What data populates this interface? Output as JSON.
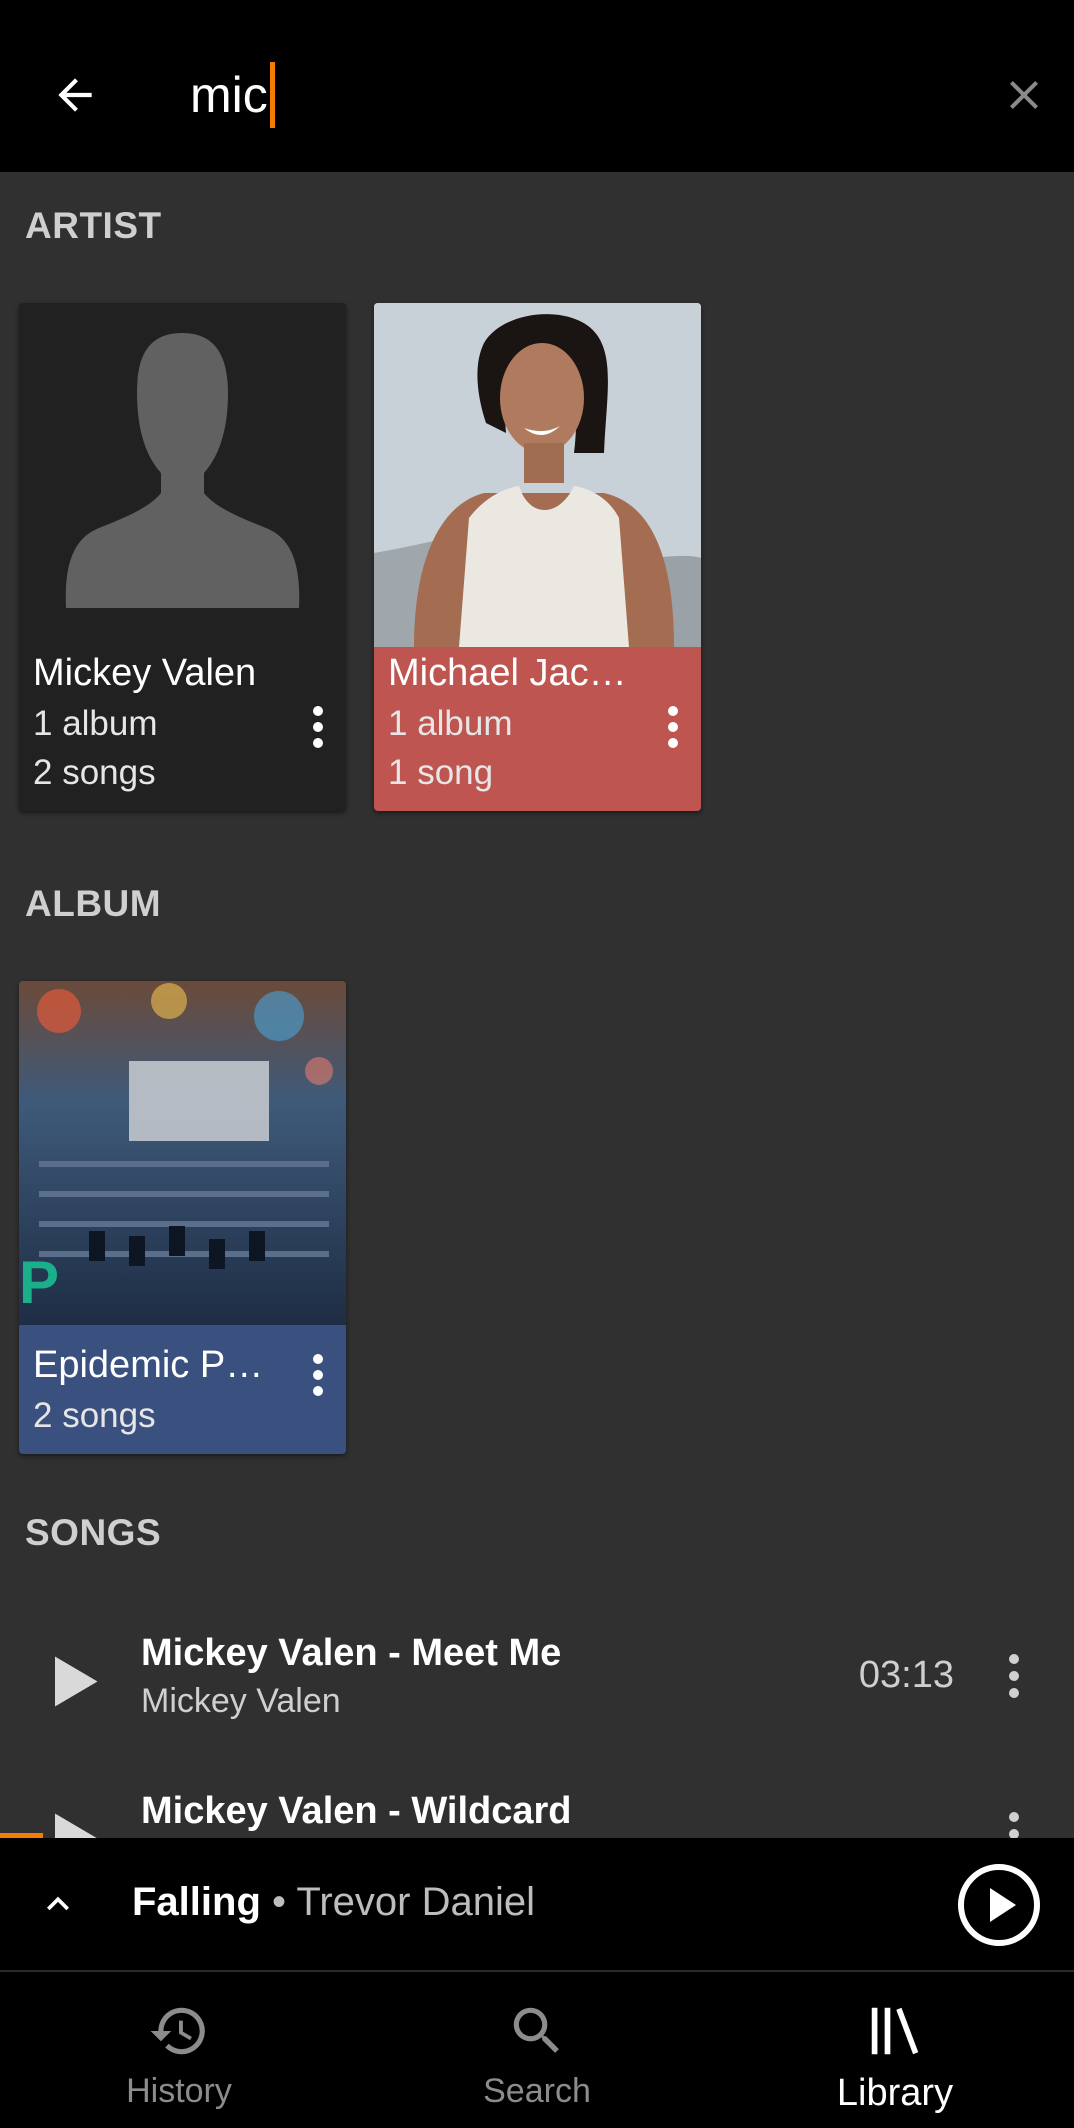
{
  "search": {
    "query": "mic"
  },
  "sections": {
    "artist": "ARTIST",
    "album": "ALBUM",
    "songs": "SONGS"
  },
  "artists": [
    {
      "name": "Mickey Valen",
      "albums": "1 album",
      "songs": "2 songs",
      "bg_color": "#212121",
      "image": "placeholder-avatar"
    },
    {
      "name": "Michael Jac…",
      "albums": "1 album",
      "songs": "1 song",
      "bg_color": "#bf5550",
      "image": "artist-photo"
    }
  ],
  "albums": [
    {
      "title": "Epidemic Po…",
      "songs": "2 songs",
      "bg_color": "#3a5180",
      "image": "mixing-console-cover"
    }
  ],
  "songs": [
    {
      "title": "Mickey Valen - Meet Me",
      "artist": "Mickey Valen",
      "duration": "03:13"
    },
    {
      "title": "Mickey Valen - Wildcard",
      "artist": "",
      "duration": ""
    }
  ],
  "now_playing": {
    "title": "Falling",
    "separator": " • ",
    "artist": "Trevor Daniel",
    "progress_fraction": 0.04
  },
  "nav": [
    {
      "label": "History",
      "icon": "history-icon",
      "active": false
    },
    {
      "label": "Search",
      "icon": "search-icon",
      "active": false
    },
    {
      "label": "Library",
      "icon": "library-icon",
      "active": true
    }
  ],
  "colors": {
    "accent": "#f57c00",
    "background": "#303030",
    "bar": "#000000"
  }
}
